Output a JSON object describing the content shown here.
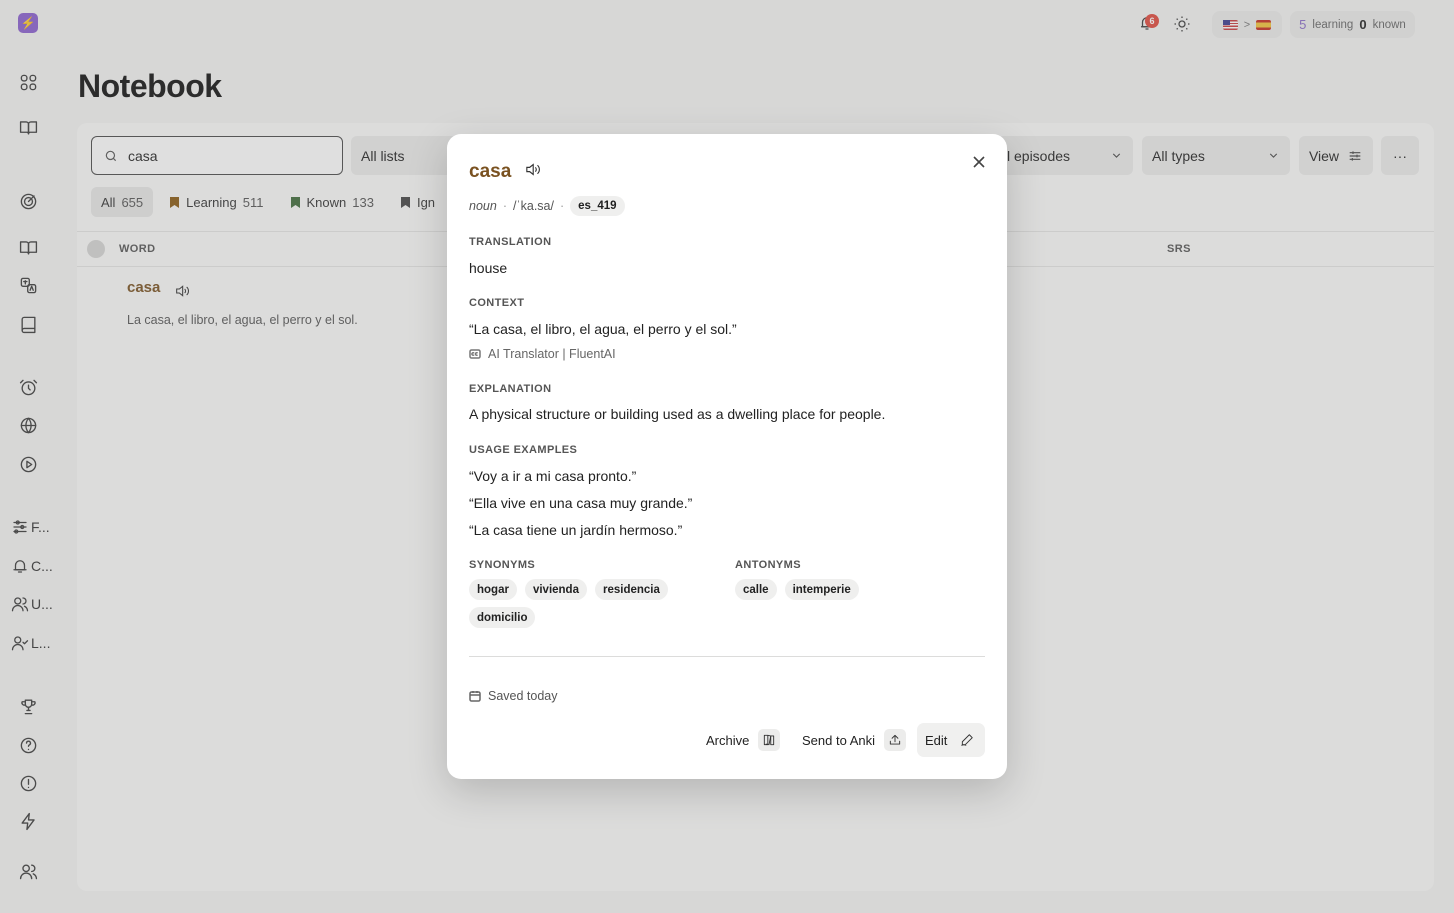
{
  "sidebar": {
    "logo": "logo-icon",
    "labeled_items": [
      {
        "label": "F..."
      },
      {
        "label": "C..."
      },
      {
        "label": "U..."
      },
      {
        "label": "L..."
      }
    ]
  },
  "topbar": {
    "notification_count": "6",
    "lang_separator": ">",
    "learning_count": "5",
    "learning_label": "learning",
    "known_count": "0",
    "known_label": "known"
  },
  "page": {
    "title": "Notebook"
  },
  "filters": {
    "search_value": "casa",
    "lists": "All lists",
    "episodes": "l episodes",
    "types": "All types",
    "view": "View",
    "more": "···"
  },
  "tabs": [
    {
      "label": "All",
      "count": "655"
    },
    {
      "label": "Learning",
      "count": "511"
    },
    {
      "label": "Known",
      "count": "133"
    },
    {
      "label": "Ign",
      "count": ""
    }
  ],
  "table": {
    "columns": {
      "word": "WORD",
      "srs": "SRS"
    },
    "row": {
      "word": "casa",
      "sentence": "La casa, el libro, el agua, el perro y el sol."
    }
  },
  "modal": {
    "word": "casa",
    "part_of_speech": "noun",
    "sep": "·",
    "ipa": "/ˈka.sa/",
    "locale": "es_419",
    "translation_label": "TRANSLATION",
    "translation": "house",
    "context_label": "CONTEXT",
    "context": "“La casa, el libro, el agua, el perro y el sol.”",
    "source": "AI Translator | FluentAI",
    "explanation_label": "EXPLANATION",
    "explanation": "A physical structure or building used as a dwelling place for people.",
    "examples_label": "USAGE EXAMPLES",
    "examples": [
      "“Voy a ir a mi casa pronto.”",
      "“Ella vive en una casa muy grande.”",
      "“La casa tiene un jardín hermoso.”"
    ],
    "synonyms_label": "SYNONYMS",
    "synonyms": [
      "hogar",
      "vivienda",
      "residencia",
      "domicilio"
    ],
    "antonyms_label": "ANTONYMS",
    "antonyms": [
      "calle",
      "intemperie"
    ],
    "saved": "Saved today",
    "archive_label": "Archive",
    "anki_label": "Send to Anki",
    "edit_label": "Edit"
  },
  "colors": {
    "word_accent": "#7a5221",
    "learning_accent": "#8a6cc8",
    "badge_red": "#e0483d",
    "bookmark_learning": "#8a5a12",
    "bookmark_known": "#3f6b3a",
    "bookmark_ignored": "#444444"
  }
}
